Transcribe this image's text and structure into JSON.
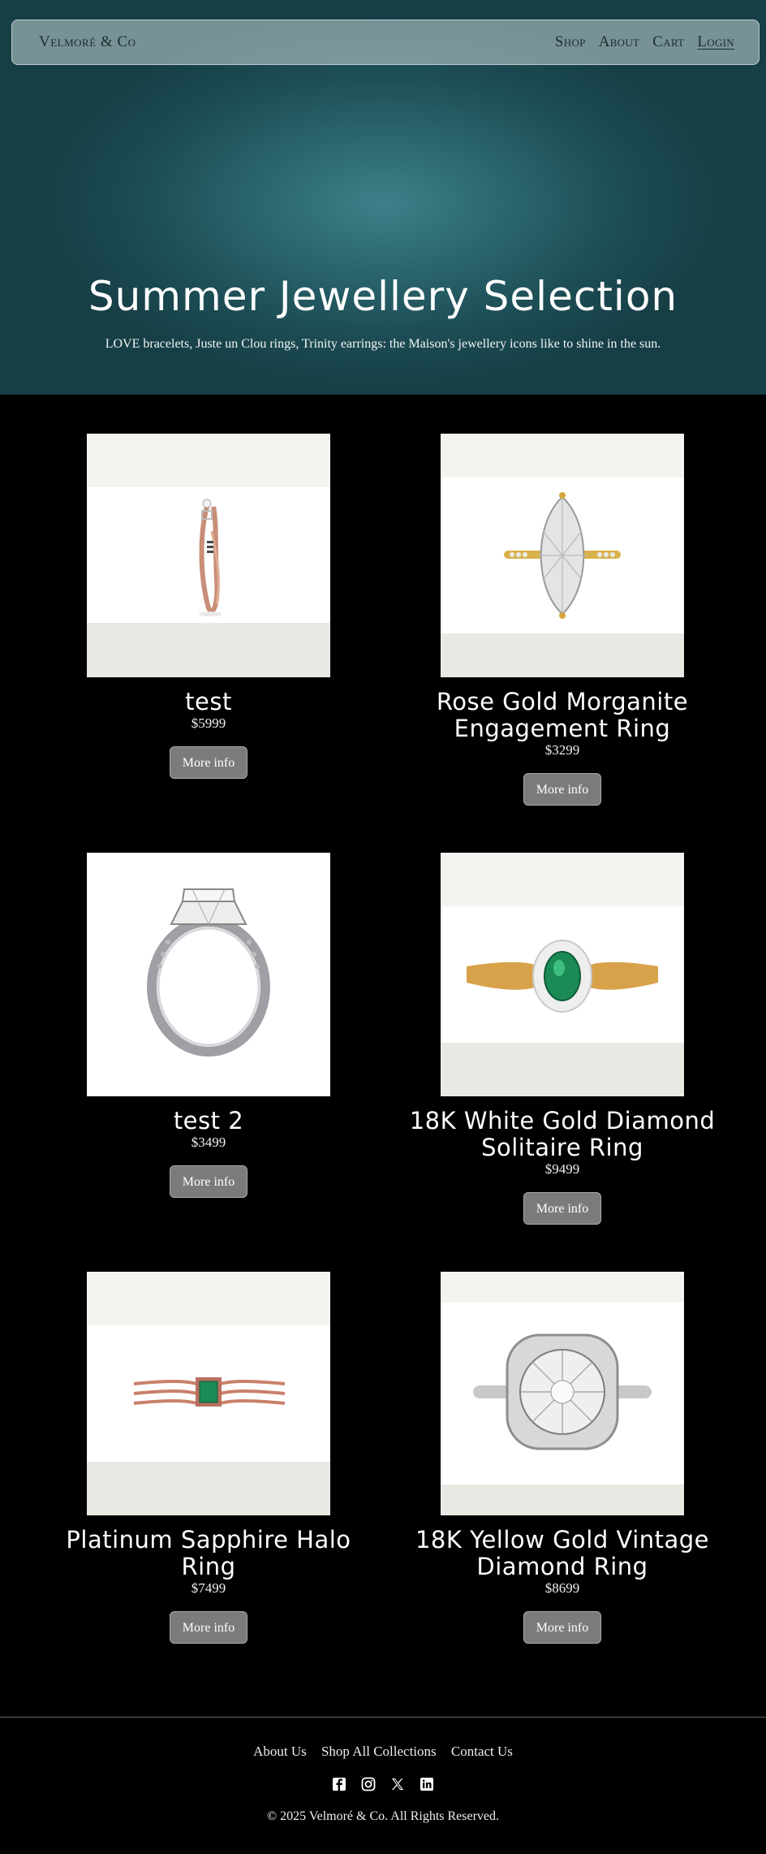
{
  "nav": {
    "brand": "Velmoré & Co",
    "links": [
      "Shop",
      "About",
      "Cart",
      "Login"
    ]
  },
  "hero": {
    "title": "Summer Jewellery Selection",
    "subtitle": "LOVE bracelets, Juste un Clou rings, Trinity earrings: the Maison's jewellery icons like to shine in the sun."
  },
  "products": [
    {
      "name": "test",
      "price": "$5999",
      "button": "More info",
      "image_icon": "rose-gold-twist-ring-icon"
    },
    {
      "name": "Rose Gold Morganite Engagement Ring",
      "price": "$3299",
      "button": "More info",
      "image_icon": "marquise-diamond-ring-icon"
    },
    {
      "name": "test 2",
      "price": "$3499",
      "button": "More info",
      "image_icon": "halo-diamond-ring-icon"
    },
    {
      "name": "18K White Gold Diamond Solitaire Ring",
      "price": "$9499",
      "button": "More info",
      "image_icon": "emerald-halo-gold-ring-icon"
    },
    {
      "name": "Platinum Sapphire Halo Ring",
      "price": "$7499",
      "button": "More info",
      "image_icon": "rose-gold-emerald-band-icon"
    },
    {
      "name": "18K Yellow Gold Vintage Diamond Ring",
      "price": "$8699",
      "button": "More info",
      "image_icon": "cushion-halo-diamond-ring-icon"
    }
  ],
  "footer": {
    "links": [
      "About Us",
      "Shop All Collections",
      "Contact Us"
    ],
    "social": [
      "facebook-icon",
      "instagram-icon",
      "x-icon",
      "linkedin-icon"
    ],
    "copyright": "© 2025 Velmoré & Co. All Rights Reserved."
  },
  "colors": {
    "hero_teal": "#2b6770",
    "button_gray": "#7b7b7b",
    "background": "#000000"
  }
}
